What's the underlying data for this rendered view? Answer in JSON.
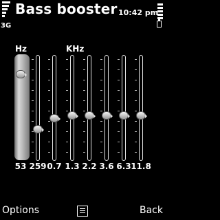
{
  "status": {
    "app_title": "Bass booster",
    "network": "3G",
    "clock": "10:42 pm",
    "signal_icon": "signal-bars-icon",
    "battery_icon": "battery-icon"
  },
  "labels": {
    "hz": "Hz",
    "khz": "KHz"
  },
  "bands": [
    {
      "freq": "53",
      "level": 0.82,
      "selected": true
    },
    {
      "freq": "259",
      "level": 0.3,
      "selected": false
    },
    {
      "freq": "0.7",
      "level": 0.4,
      "selected": false
    },
    {
      "freq": "1.3",
      "level": 0.43,
      "selected": false
    },
    {
      "freq": "2.2",
      "level": 0.43,
      "selected": false
    },
    {
      "freq": "3.6",
      "level": 0.43,
      "selected": false
    },
    {
      "freq": "6.3",
      "level": 0.43,
      "selected": false
    },
    {
      "freq": "11.8",
      "level": 0.43,
      "selected": false
    }
  ],
  "softkeys": {
    "left": "Options",
    "right": "Back",
    "middle_icon": "menu-icon"
  }
}
